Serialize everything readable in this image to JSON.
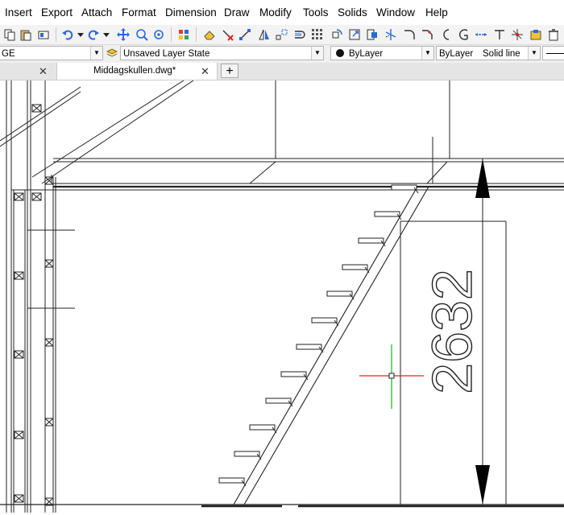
{
  "menu": [
    "Insert",
    "Export",
    "Attach",
    "Format",
    "Dimension",
    "Draw",
    "Modify",
    "Tools",
    "Solids",
    "Window",
    "Help"
  ],
  "toolbar": {
    "icons": [
      "copy-icon",
      "paste-icon",
      "match-properties-icon",
      "undo-icon",
      "redo-icon",
      "pan-icon",
      "zoom-window-icon",
      "zoom-realtime-icon",
      "layer-manager-icon",
      "eraser-icon",
      "erase-icon",
      "line-icon",
      "mirror-icon",
      "scale-icon",
      "offset-icon",
      "array-icon",
      "rotate-icon",
      "stretch-icon",
      "move-icon",
      "trim-icon",
      "fillet-icon",
      "chamfer-icon",
      "extend-icon",
      "break-icon",
      "explode-icon",
      "block-icon",
      "purge-icon"
    ]
  },
  "properties": {
    "layer_value": "GE",
    "layer_state": "Unsaved Layer State",
    "color": "ByLayer",
    "linetype": "ByLayer",
    "lineweight_label": "Solid line"
  },
  "tabs": [
    {
      "label": "",
      "active": false
    },
    {
      "label": "Middagskullen.dwg*",
      "active": true
    }
  ],
  "drawing": {
    "dimension_text": "2632",
    "crosshair_color_x": "#e02020",
    "crosshair_color_y": "#20b020"
  }
}
